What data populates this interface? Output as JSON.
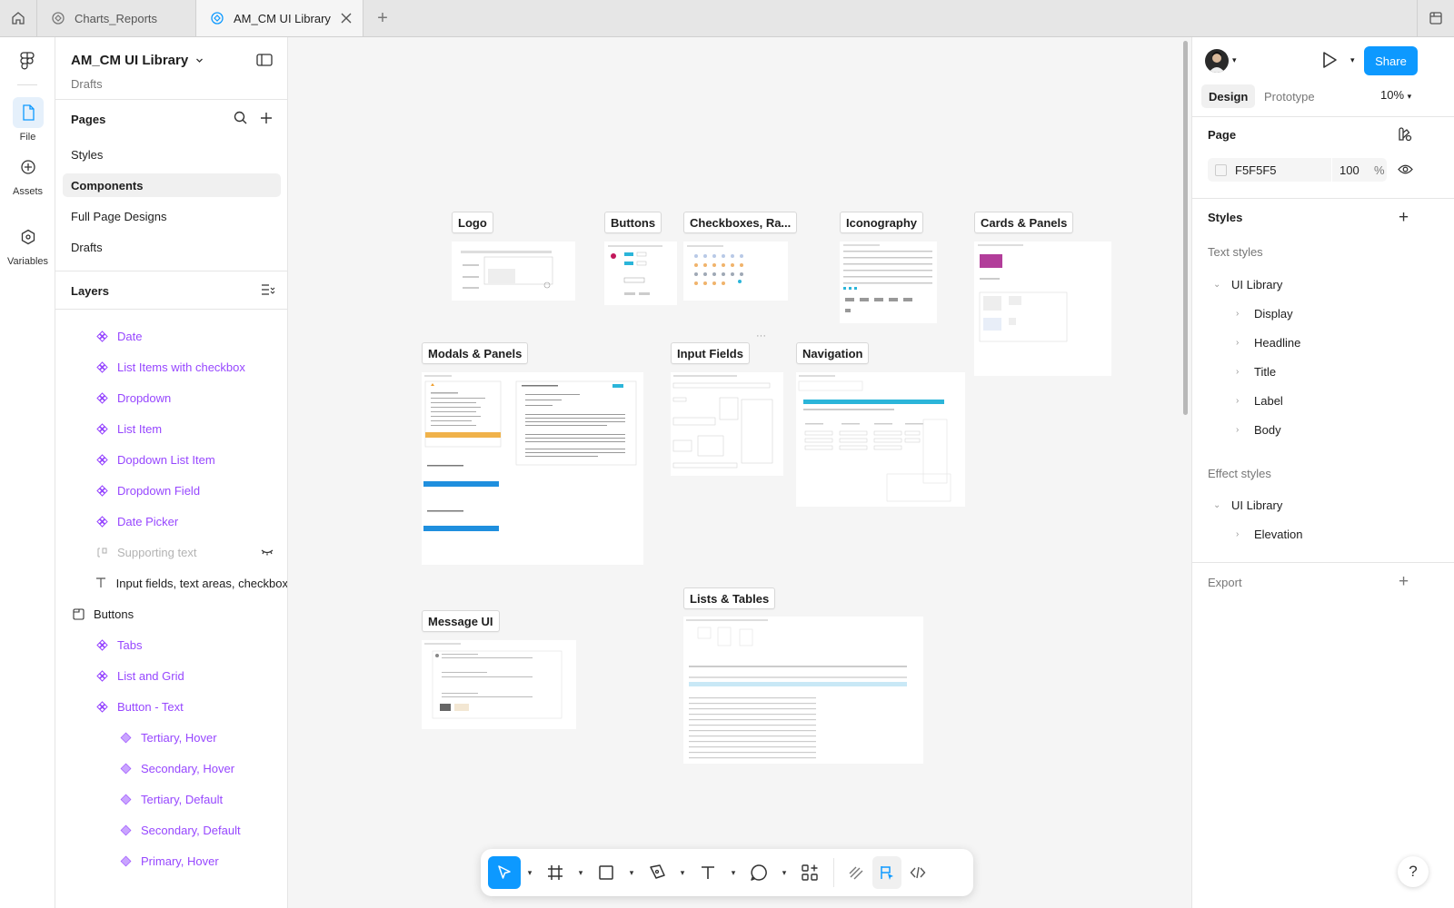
{
  "tabs": [
    {
      "label": "Charts_Reports",
      "active": false
    },
    {
      "label": "AM_CM UI Library",
      "active": true
    }
  ],
  "rail": {
    "file_label": "File",
    "assets_label": "Assets",
    "variables_label": "Variables"
  },
  "file": {
    "name": "AM_CM UI Library",
    "location": "Drafts"
  },
  "pages": {
    "heading": "Pages",
    "items": [
      "Styles",
      "Components",
      "Full Page Designs",
      "Drafts"
    ],
    "selected": "Components"
  },
  "layers": {
    "heading": "Layers",
    "items": [
      {
        "label": "Date",
        "kind": "component"
      },
      {
        "label": "List Items with checkbox",
        "kind": "component"
      },
      {
        "label": "Dropdown",
        "kind": "component"
      },
      {
        "label": "List Item",
        "kind": "component"
      },
      {
        "label": "Dopdown List Item",
        "kind": "component"
      },
      {
        "label": "Dropdown Field",
        "kind": "component"
      },
      {
        "label": "Date Picker",
        "kind": "component"
      },
      {
        "label": "Supporting text",
        "kind": "hidden"
      },
      {
        "label": "Input fields, text areas, checkbox",
        "kind": "text"
      },
      {
        "label": "Buttons",
        "kind": "frame"
      },
      {
        "label": "Tabs",
        "kind": "component"
      },
      {
        "label": "List and Grid",
        "kind": "component"
      },
      {
        "label": "Button - Text",
        "kind": "component"
      },
      {
        "label": "Tertiary, Hover",
        "kind": "variant"
      },
      {
        "label": "Secondary, Hover",
        "kind": "variant"
      },
      {
        "label": "Tertiary, Default",
        "kind": "variant"
      },
      {
        "label": "Secondary, Default",
        "kind": "variant"
      },
      {
        "label": "Primary, Hover",
        "kind": "variant"
      }
    ]
  },
  "canvas": {
    "frames": [
      "Logo",
      "Buttons",
      "Checkboxes, Ra...",
      "Iconography",
      "Cards & Panels",
      "Modals & Panels",
      "Input Fields",
      "Navigation",
      "Message UI",
      "Lists & Tables"
    ]
  },
  "right": {
    "share_label": "Share",
    "tab_design": "Design",
    "tab_prototype": "Prototype",
    "zoom": "10%",
    "page_heading": "Page",
    "page_color": "F5F5F5",
    "page_opacity": "100",
    "page_opacity_unit": "%",
    "styles_heading": "Styles",
    "text_styles_label": "Text styles",
    "text_library": "UI Library",
    "text_styles": [
      "Display",
      "Headline",
      "Title",
      "Label",
      "Body"
    ],
    "effect_styles_label": "Effect styles",
    "effect_library": "UI Library",
    "effect_styles": [
      "Elevation"
    ],
    "export_heading": "Export"
  },
  "colors": {
    "accent": "#0d99ff",
    "component": "#9747ff",
    "canvas_bg": "#f5f5f5"
  }
}
